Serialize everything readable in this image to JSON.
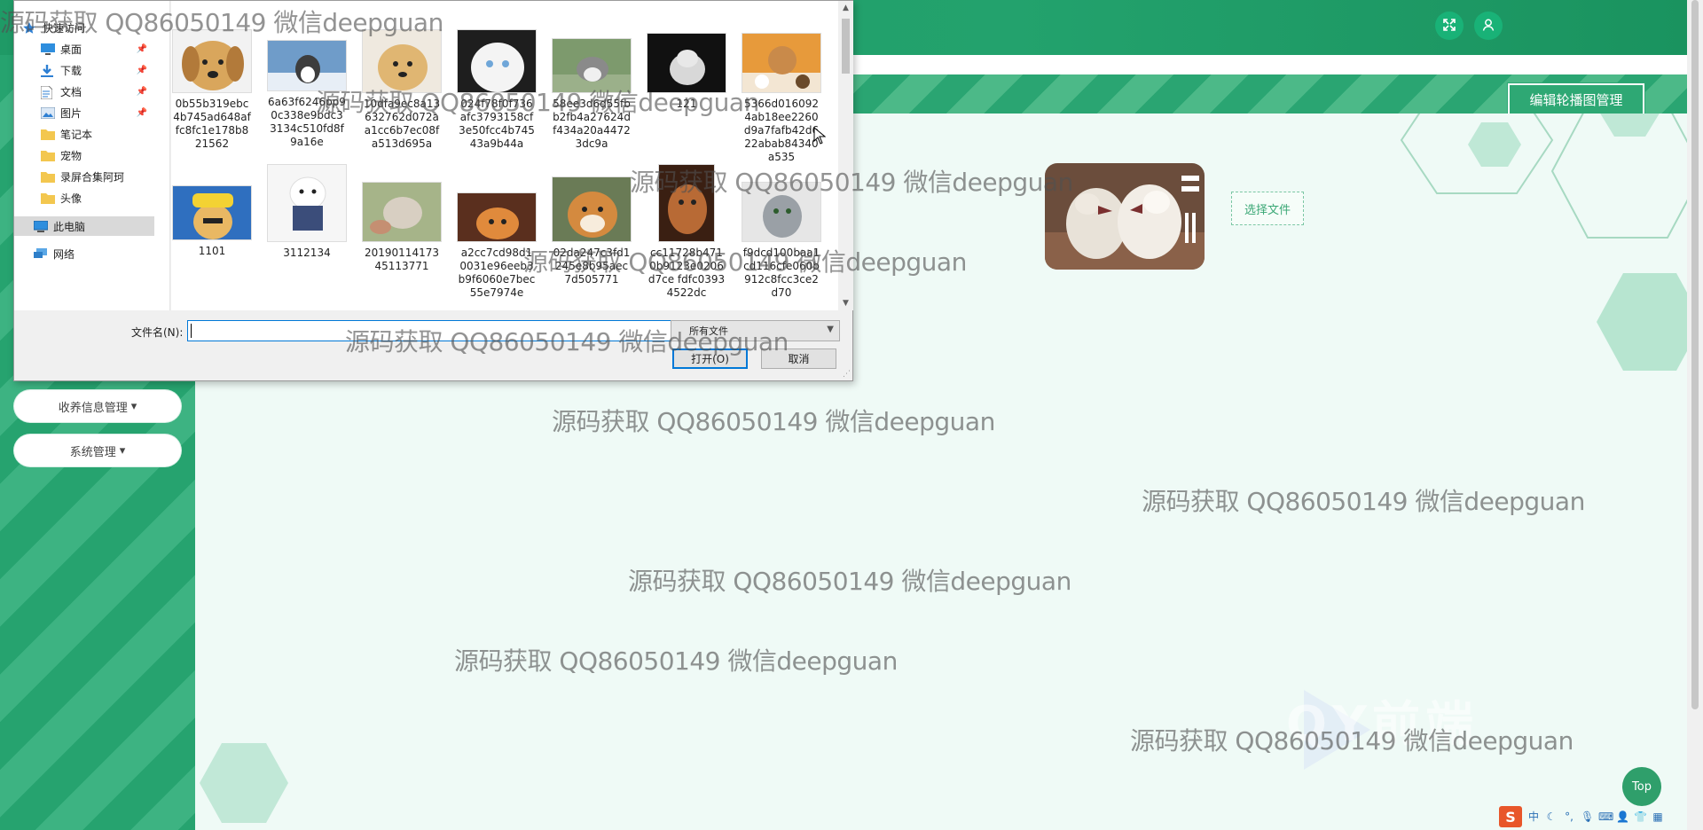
{
  "header": {
    "fullscreen_icon": "expand-icon",
    "user_icon": "user-icon"
  },
  "banner": {
    "edit_carousel_label": "编辑轮播图管理"
  },
  "sidebar": {
    "items": [
      {
        "label": "收养信息管理",
        "caret": "▾"
      },
      {
        "label": "系统管理",
        "caret": "▾"
      }
    ]
  },
  "upload": {
    "select_file_label": "选择文件"
  },
  "top_button": {
    "label": "Top"
  },
  "dialog": {
    "nav": [
      {
        "label": "快速访问",
        "icon": "star-icon"
      },
      {
        "label": "桌面",
        "icon": "desktop-icon",
        "pinned": true
      },
      {
        "label": "下载",
        "icon": "download-icon",
        "pinned": true
      },
      {
        "label": "文档",
        "icon": "document-icon",
        "pinned": true
      },
      {
        "label": "图片",
        "icon": "pictures-icon",
        "pinned": true
      },
      {
        "label": "笔记本",
        "icon": "folder-icon"
      },
      {
        "label": "宠物",
        "icon": "folder-icon"
      },
      {
        "label": "录屏合集阿珂",
        "icon": "folder-icon"
      },
      {
        "label": "头像",
        "icon": "folder-icon"
      },
      {
        "label": "此电脑",
        "icon": "computer-icon",
        "selected": true
      },
      {
        "label": "网络",
        "icon": "network-icon"
      }
    ],
    "files": [
      {
        "name": "0b55b319ebc4b745ad648affc8fc1e178b821562"
      },
      {
        "name": "6a63f6246pp90c338e9bdc33134c510fd8f9a16e"
      },
      {
        "name": "10dfa9ec8a13632762d072aa1cc6b7ec08fa513d695a"
      },
      {
        "name": "024f78f0f736afc3793158cf3e50fcc4b74543a9b44a"
      },
      {
        "name": "58ee3d6d55fbb2fb4a27624df434a20a44723dc9a"
      },
      {
        "name": "121"
      },
      {
        "name": "5366d0160924ab18ee2260d9a7fafb42d622abab84340a535"
      },
      {
        "name": "1101"
      },
      {
        "name": "3112134"
      },
      {
        "name": "2019011417345113771"
      },
      {
        "name": "a2cc7cd98d10031e96eeb3b9f6060e7bec55e7974e"
      },
      {
        "name": "02da247c3fd1245e8b95aec7d505771"
      },
      {
        "name": "cc11728b4710b9123e0206d7ce fdfc03934522dc"
      },
      {
        "name": "f9dcd100baa1cd116cfe060b912c8fcc3ce2d70"
      }
    ],
    "filename_label": "文件名(N):",
    "filename_value": "",
    "filetype_value": "所有文件",
    "open_label": "打开(O)",
    "cancel_label": "取消"
  },
  "watermarks": [
    "源码获取 QQ86050149 微信deepguan",
    "源码获取 QQ86050149 微信deepguan",
    "源码获取 QQ86050149 微信deepguan",
    "源码获取 QQ86050149 微信deepguan",
    "源码获取 QQ86050149 微信deepguan",
    "源码获取 QQ86050149 微信deepguan",
    "源码获取 QQ86050149 微信deepguan",
    "源码获取 QQ86050149 微信deepguan",
    "源码获取 QQ86050149 微信deepguan",
    "源码获取 QQ86050149 微信deepguan"
  ],
  "brand_watermark": "QY前端",
  "tray": {
    "ime": "S",
    "ime_mode": "中"
  },
  "colors": {
    "primary": "#23a26d",
    "accent": "#19b277",
    "dialog_focus": "#0078d7"
  }
}
